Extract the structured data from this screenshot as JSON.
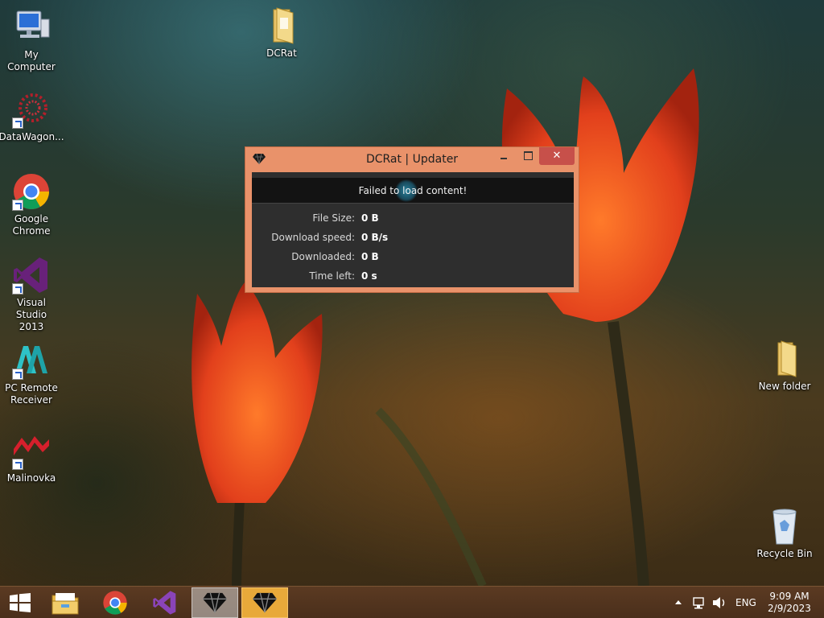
{
  "desktop": {
    "icons": [
      {
        "label": "My Computer",
        "icon": "computer-icon"
      },
      {
        "label": "DCRat",
        "icon": "folder-icon"
      },
      {
        "label": "DataWagon...",
        "icon": "datawagon-icon"
      },
      {
        "label": "Google Chrome",
        "icon": "chrome-icon"
      },
      {
        "label": "Visual Studio 2013",
        "icon": "visual-studio-icon"
      },
      {
        "label": "PC Remote Receiver",
        "icon": "pc-remote-icon"
      },
      {
        "label": "Malinovka",
        "icon": "malinovka-icon"
      },
      {
        "label": "New folder",
        "icon": "folder-icon"
      },
      {
        "label": "Recycle Bin",
        "icon": "recycle-bin-icon"
      }
    ]
  },
  "updater_window": {
    "title": "DCRat | Updater",
    "icon": "diamond-icon",
    "close_glyph": "✕",
    "status_message": "Failed to load content!",
    "rows": [
      {
        "label": "File Size:",
        "value": "0 B"
      },
      {
        "label": "Download speed:",
        "value": "0 B/s"
      },
      {
        "label": "Downloaded:",
        "value": "0 B"
      },
      {
        "label": "Time left:",
        "value": "0 s"
      }
    ]
  },
  "taskbar": {
    "pinned": [
      {
        "icon": "windows-start-icon"
      },
      {
        "icon": "file-explorer-icon"
      },
      {
        "icon": "chrome-icon"
      },
      {
        "icon": "visual-studio-icon"
      },
      {
        "icon": "diamond-icon",
        "state": "active"
      },
      {
        "icon": "diamond-icon",
        "state": "highlighted"
      }
    ],
    "tray": {
      "language": "ENG",
      "time": "9:09 AM",
      "date": "2/9/2023"
    }
  },
  "colors": {
    "window_frame": "#e9926a",
    "close_button": "#c7504a",
    "window_body": "#2e2e2e",
    "taskbar": "#4a2f1b",
    "highlight_task": "#e8a93a"
  }
}
